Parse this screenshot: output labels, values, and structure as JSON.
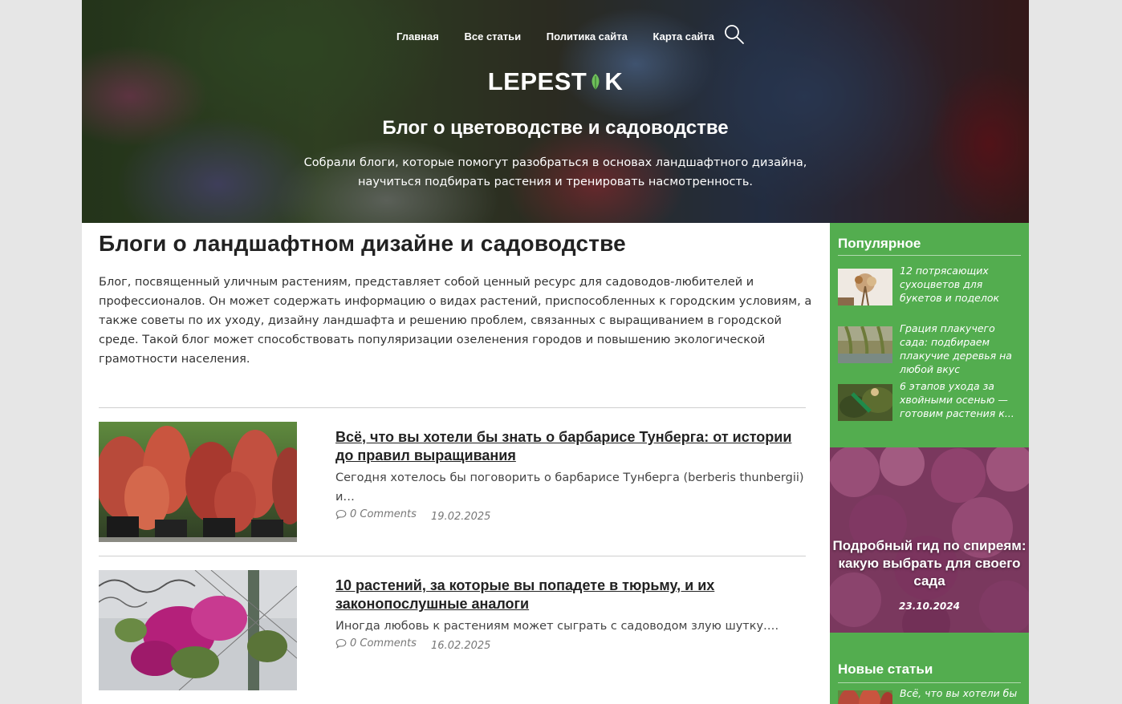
{
  "nav": {
    "items": [
      "Главная",
      "Все статьи",
      "Политика сайта",
      "Карта сайта"
    ]
  },
  "hero": {
    "logo_left": "LEPEST",
    "logo_right": "K",
    "title": "Блог о цветоводстве и садоводстве",
    "subtitle": "Собрали блоги, которые помогут разобраться в основах ландшафтного дизайна, научиться подбирать растения и тренировать насмотренность."
  },
  "main": {
    "title": "Блоги о ландшафтном дизайне и садоводстве",
    "intro": "Блог, посвященный уличным растениям, представляет собой ценный ресурс для садоводов-любителей и профессионалов. Он может содержать информацию о видах растений, приспособленных к городским условиям, а также советы по их уходу, дизайну ландшафта и решению проблем, связанных с выращиванием в городской среде. Такой блог может способствовать популяризации озеленения городов и повышению экологической грамотности населения.",
    "posts": [
      {
        "title": "Всё, что вы хотели бы знать о барбарисе Тунберга: от истории до правил выращивания",
        "excerpt": "Сегодня хотелось бы поговорить о барбарисе Тунберга (berberis thunbergii) и…",
        "comments": "0 Comments",
        "date": "19.02.2025"
      },
      {
        "title": "10 растений, за которые вы попадете в тюрьму, и их законопослушные аналоги",
        "excerpt": "Иногда любовь к растениям может сыграть с садоводом злую шутку.…",
        "comments": "0 Comments",
        "date": "16.02.2025"
      }
    ]
  },
  "sidebar": {
    "popular_heading": "Популярное",
    "popular": [
      "12 потрясающих сухоцветов для букетов и поделок",
      "Грация плакучего сада: подбираем плакучие деревья на любой вкус",
      "6 этапов ухода за хвойными осенью — готовим растения к..."
    ],
    "featured": {
      "title": "Подробный гид по спиреям: какую выбрать для своего сада",
      "date": "23.10.2024"
    },
    "new_heading": "Новые статьи",
    "new_items": [
      "Всё, что вы хотели бы"
    ]
  },
  "colors": {
    "sidebar_green": "#53ad4f",
    "page_bg": "#e6e6e6"
  }
}
